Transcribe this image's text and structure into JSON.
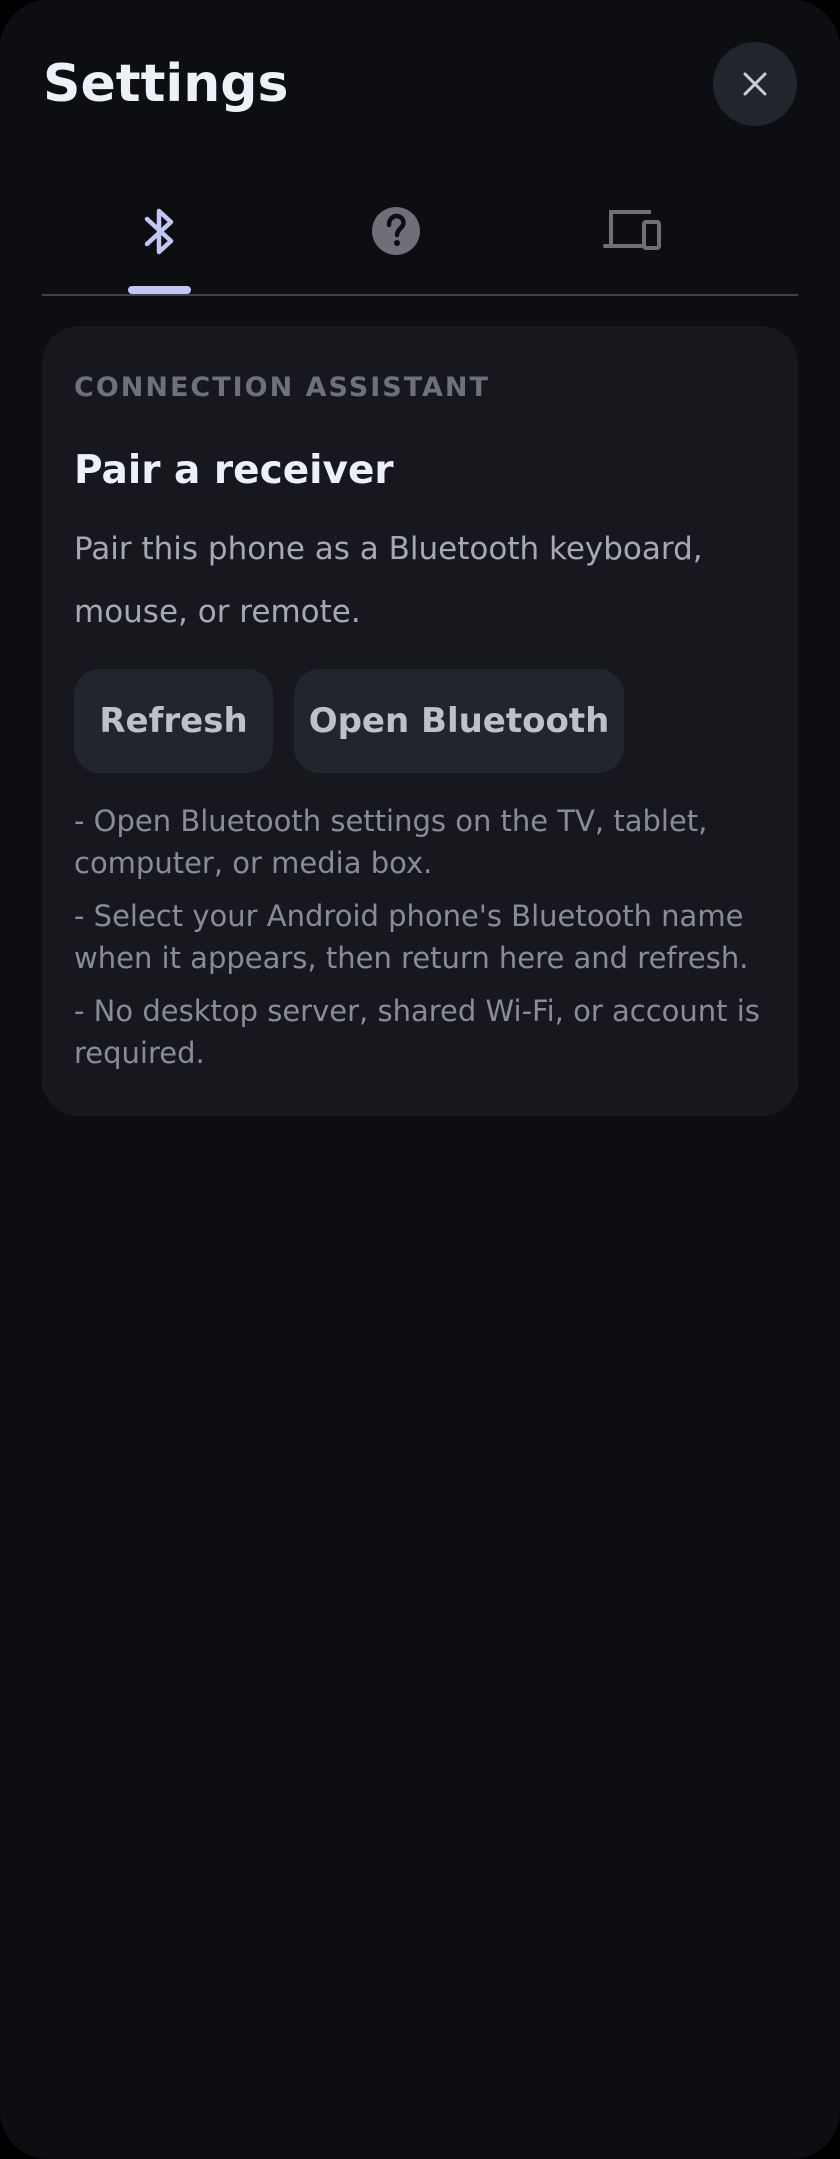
{
  "header": {
    "title": "Settings",
    "close_icon": "close-icon"
  },
  "tabs": [
    {
      "icon": "bluetooth-icon",
      "selected": true
    },
    {
      "icon": "help-icon",
      "selected": false
    },
    {
      "icon": "devices-icon",
      "selected": false
    }
  ],
  "card": {
    "eyebrow": "CONNECTION ASSISTANT",
    "title": "Pair a receiver",
    "description": "Pair this phone as a Bluetooth keyboard, mouse, or remote.",
    "buttons": {
      "refresh": "Refresh",
      "open_bluetooth": "Open Bluetooth"
    },
    "steps": [
      "- Open Bluetooth settings on the TV, tablet, computer, or media box.",
      "- Select your Android phone's Bluetooth name when it appears, then return here and refresh.",
      "- No desktop server, shared Wi-Fi, or account is required."
    ]
  },
  "colors": {
    "background": "#0d0e12",
    "card": "#17181d",
    "accent": "#c2c8f3",
    "button": "#23252e",
    "icon_inactive": "#6f7077"
  }
}
